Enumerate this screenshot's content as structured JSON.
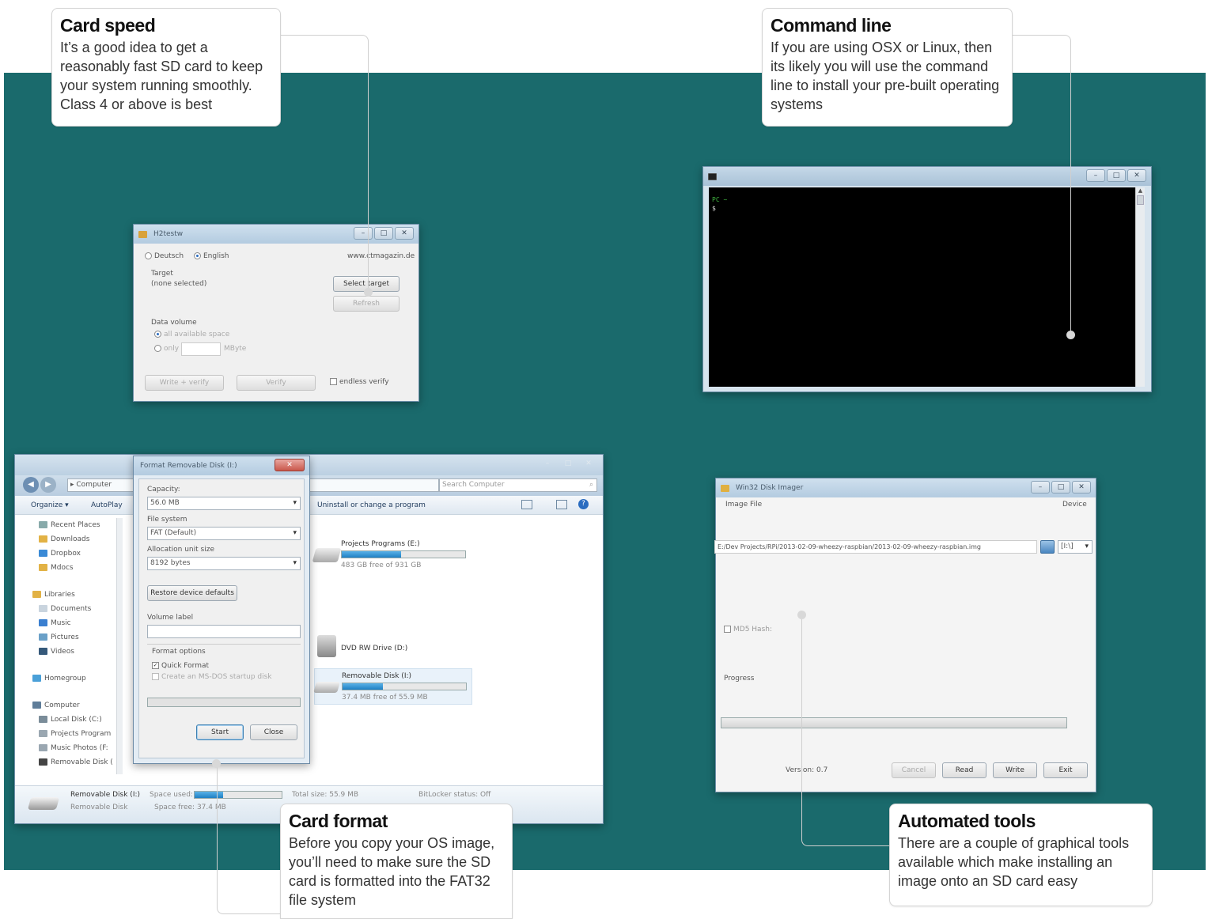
{
  "callouts": {
    "card_speed": {
      "title": "Card speed",
      "body": "It’s a good idea to get a reasonably fast SD card to keep your system running smoothly. Class 4 or above is best"
    },
    "command_line": {
      "title": "Command line",
      "body": "If you are using OSX or Linux, then its likely you will use the command line to install your pre-built operating systems"
    },
    "card_format": {
      "title": "Card format",
      "body": "Before you copy your OS image, you’ll need to make sure the SD card is formatted into the FAT32 file system"
    },
    "automated_tools": {
      "title": "Automated tools",
      "body": "There are a couple of graphical tools available which make installing an image onto an SD card easy"
    }
  },
  "h2testw": {
    "title": "H2testw",
    "lang_deutsch": "Deutsch",
    "lang_english": "English",
    "website": "www.ctmagazin.de",
    "target_label": "Target",
    "target_value": "(none selected)",
    "select_target": "Select target",
    "refresh": "Refresh",
    "data_volume": "Data volume",
    "all_space": "all available space",
    "only": "only",
    "mbyte": "MByte",
    "write_verify": "Write + verify",
    "verify": "Verify",
    "endless_verify": "endless verify"
  },
  "terminal": {
    "title": "",
    "prompt": "PC ~",
    "cursor": "$"
  },
  "explorer": {
    "breadcrumb": "Computer",
    "search_placeholder": "Search Computer",
    "toolbar": {
      "organize": "Organize ▾",
      "autoplay": "AutoPlay",
      "uninstall": "Uninstall or change a program"
    },
    "favorites": [
      "Recent Places",
      "Downloads",
      "Dropbox",
      "Mdocs"
    ],
    "libraries_label": "Libraries",
    "libraries": [
      "Documents",
      "Music",
      "Pictures",
      "Videos"
    ],
    "homegroup": "Homegroup",
    "computer_label": "Computer",
    "computer_items": [
      "Local Disk (C:)",
      "Projects Program",
      "Music Photos (F:",
      "Removable Disk ("
    ],
    "drives": [
      {
        "name": "Projects Programs (E:)",
        "free": "483 GB free of 931 GB",
        "fill": 0.48
      },
      {
        "name": "DVD RW Drive (D:)",
        "free": "",
        "fill": null
      },
      {
        "name": "Removable Disk (I:)",
        "free": "37.4 MB free of 55.9 MB",
        "fill": 0.33
      }
    ],
    "status": {
      "name": "Removable Disk (I:)",
      "type": "Removable Disk",
      "space_used_label": "Space used:",
      "space_free_label": "Space free:",
      "space_free": "37.4 MB",
      "total_size": "Total size: 55.9 MB",
      "bitlocker": "BitLocker status: Off",
      "used_fraction": 0.33
    }
  },
  "format_dialog": {
    "title": "Format Removable Disk (I:)",
    "capacity_label": "Capacity:",
    "capacity_value": "56.0 MB",
    "fs_label": "File system",
    "fs_value": "FAT (Default)",
    "alloc_label": "Allocation unit size",
    "alloc_value": "8192 bytes",
    "restore": "Restore device defaults",
    "volume_label": "Volume label",
    "volume_value": "",
    "options_label": "Format options",
    "quick_format": "Quick Format",
    "msdos": "Create an MS-DOS startup disk",
    "start": "Start",
    "close": "Close"
  },
  "win32imager": {
    "title": "Win32 Disk Imager",
    "image_file_label": "Image File",
    "device_label": "Device",
    "image_path": "E:/Dev Projects/RPi/2013-02-09-wheezy-raspbian/2013-02-09-wheezy-raspbian.img",
    "device_value": "[I:\\]",
    "md5_label": "MD5 Hash:",
    "progress_label": "Progress",
    "version": "Version: 0.7",
    "cancel": "Cancel",
    "read": "Read",
    "write": "Write",
    "exit": "Exit"
  }
}
